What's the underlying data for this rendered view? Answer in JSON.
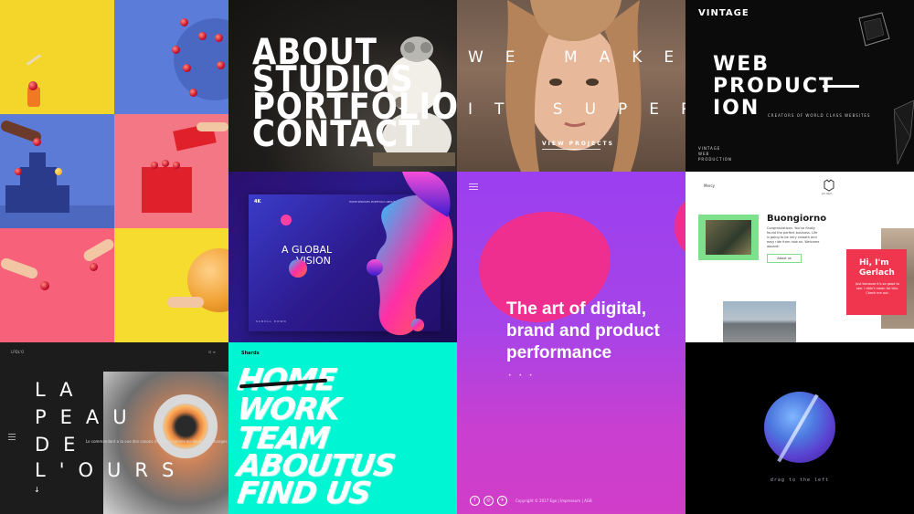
{
  "tile_about": {
    "menu": [
      "ABOUT",
      "STUDIOS",
      "PORTFOLIO",
      "CONTACT"
    ]
  },
  "tile_superb": {
    "line1": "WE MAKE",
    "line2": "IT SUPER",
    "cta": "VIEW PROJECTS"
  },
  "tile_vintage": {
    "logo": "VINTAGE",
    "title": [
      "WEB",
      "PRODUCT",
      "ION"
    ],
    "tagline": "CREATORS OF WORLD CLASS WEBSITES",
    "side": [
      "VINTAGE",
      "WEB",
      "PRODUCTION"
    ]
  },
  "tile_vision": {
    "brand": "4K",
    "headline": [
      "A GLOBAL",
      "VISION"
    ],
    "nav": "HOME  SERVICES  PORTFOLIO  ABOUT  CONTACT",
    "scroll": "SCROLL DOWN"
  },
  "tile_digital": {
    "headline": [
      "The art of digital,",
      "brand and product",
      "performance"
    ],
    "dots": "• • •",
    "social": [
      "f",
      "◎",
      "✈"
    ],
    "footer": "Copyright © 2017 Ego  |  Impressum  |  AGB"
  },
  "tile_buongiorno": {
    "logo": "Mercy",
    "icon_label": "ph.dam",
    "title": "Buongiorno",
    "body": "Congratulations. You've finally found the perfect business. Life is going to be very smooth and easy ride from now on. Welcome aboard!",
    "button": "About us",
    "card_title": [
      "Hi, I'm",
      "Gerlach"
    ],
    "card_body": "Just because it's so good to see. I didn't mean for this. Check me out."
  },
  "tile_ours": {
    "top_left": "LPDL'O",
    "top_right": "⊡  ≡",
    "words": [
      "LA",
      "PEAU",
      "DE",
      "L'OURS"
    ],
    "caption": "Le commandant a la vue des canons manimes calmes au deuxieme phanges",
    "arrow": "↓"
  },
  "tile_brush": {
    "logo": "Shards",
    "words": [
      "HOME",
      "WORK",
      "TEAM",
      "ABOUTUS",
      "FIND US"
    ]
  },
  "tile_sphere": {
    "label": "drag to the left"
  }
}
